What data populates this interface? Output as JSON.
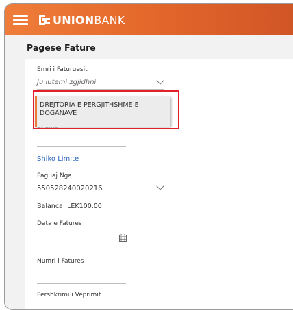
{
  "header": {
    "logo_bold": "UNION",
    "logo_light": "BANK"
  },
  "page": {
    "title": "Pagese Fature"
  },
  "form": {
    "biller": {
      "label": "Emri i Faturuesit",
      "placeholder": "Ju lutemi zgjidhni"
    },
    "dropdown_option": "DREJTORIA E PERGJITHSHME E DOGANAVE",
    "amount": {
      "label": "Shuma"
    },
    "limits_link": "Shiko Limite",
    "from_account": {
      "label": "Paguaj Nga",
      "value": "550528240020216"
    },
    "balance": "Balanca: LEK100.00",
    "invoice_date": {
      "label": "Data e Fatures"
    },
    "invoice_number": {
      "label": "Numri i Fatures"
    },
    "description": {
      "label": "Pershkrimi i Veprimit"
    }
  },
  "colors": {
    "brand_orange": "#e4692c",
    "link_blue": "#2a64b8",
    "highlight_red": "#e0202a"
  }
}
